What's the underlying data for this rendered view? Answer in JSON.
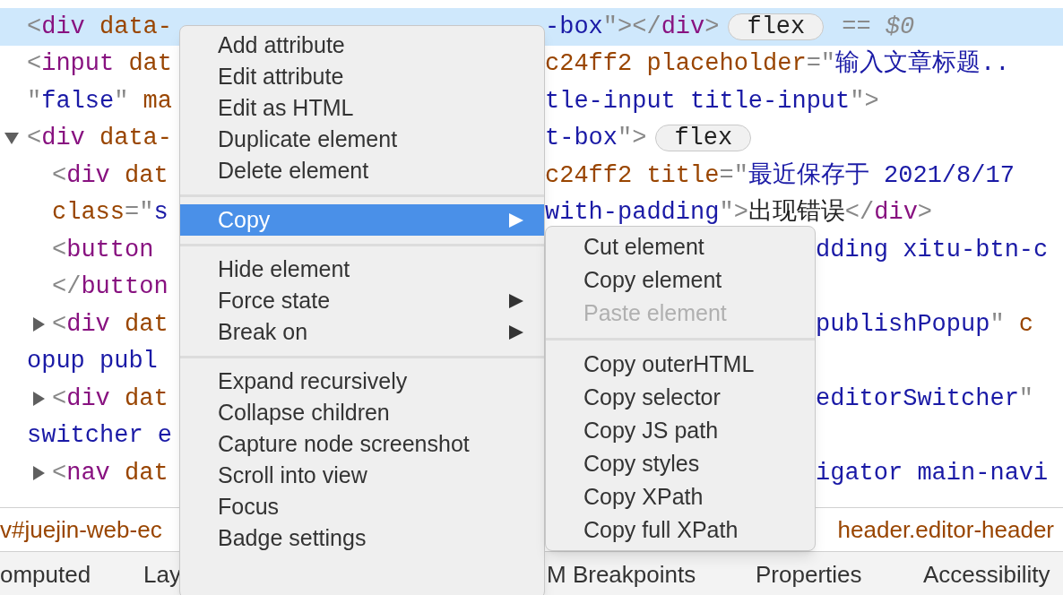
{
  "elements_tree": {
    "nodes": [
      {
        "selected": true,
        "badge": "flex",
        "console_ref": "== $0",
        "lines": [
          {
            "left": [
              {
                "kind": "punct",
                "text": "<"
              },
              {
                "kind": "tag",
                "text": "div"
              },
              {
                "kind": "attr",
                "text": " data-"
              }
            ],
            "right": [
              {
                "kind": "value",
                "text": "-box"
              },
              {
                "kind": "punct",
                "text": "\"></"
              },
              {
                "kind": "tag",
                "text": "div"
              },
              {
                "kind": "punct",
                "text": ">"
              }
            ]
          }
        ]
      },
      {
        "selected": false,
        "lines": [
          {
            "left": [
              {
                "kind": "punct",
                "text": "<"
              },
              {
                "kind": "tag",
                "text": "input"
              },
              {
                "kind": "attr",
                "text": " dat"
              }
            ],
            "right": [
              {
                "kind": "attr",
                "text": "c24ff2 placeholder"
              },
              {
                "kind": "punct",
                "text": "=\""
              },
              {
                "kind": "value",
                "text": "输入文章标题.."
              }
            ]
          },
          {
            "left": [
              {
                "kind": "punct",
                "text": "\""
              },
              {
                "kind": "value",
                "text": "false"
              },
              {
                "kind": "punct",
                "text": "\""
              },
              {
                "kind": "attr",
                "text": " ma"
              }
            ],
            "right": [
              {
                "kind": "value",
                "text": "tle-input title-input"
              },
              {
                "kind": "punct",
                "text": "\">"
              }
            ]
          }
        ]
      },
      {
        "selected": false,
        "expanded": true,
        "badge": "flex",
        "lines": [
          {
            "left": [
              {
                "kind": "punct",
                "text": "<"
              },
              {
                "kind": "tag",
                "text": "div"
              },
              {
                "kind": "attr",
                "text": " data-"
              }
            ],
            "right": [
              {
                "kind": "value",
                "text": "t-box"
              },
              {
                "kind": "punct",
                "text": "\">"
              }
            ]
          }
        ],
        "children": [
          {
            "selected": false,
            "lines": [
              {
                "left": [
                  {
                    "kind": "punct",
                    "text": "<"
                  },
                  {
                    "kind": "tag",
                    "text": "div"
                  },
                  {
                    "kind": "attr",
                    "text": " dat"
                  }
                ],
                "right": [
                  {
                    "kind": "attr",
                    "text": "c24ff2 title"
                  },
                  {
                    "kind": "punct",
                    "text": "=\""
                  },
                  {
                    "kind": "value",
                    "text": "最近保存于 2021/8/17"
                  }
                ]
              },
              {
                "left": [
                  {
                    "kind": "attr",
                    "text": "class"
                  },
                  {
                    "kind": "punct",
                    "text": "=\""
                  },
                  {
                    "kind": "value",
                    "text": "s"
                  }
                ],
                "right": [
                  {
                    "kind": "value",
                    "text": "with-padding"
                  },
                  {
                    "kind": "punct",
                    "text": "\">"
                  },
                  {
                    "kind": "content",
                    "text": "出现错误"
                  },
                  {
                    "kind": "punct",
                    "text": "</"
                  },
                  {
                    "kind": "tag",
                    "text": "div"
                  },
                  {
                    "kind": "punct",
                    "text": ">"
                  }
                ]
              }
            ]
          },
          {
            "selected": false,
            "lines": [
              {
                "left": [
                  {
                    "kind": "punct",
                    "text": "<"
                  },
                  {
                    "kind": "tag",
                    "text": "button"
                  }
                ],
                "right": [
                  {
                    "kind": "value",
                    "text": "dding xitu-btn-c"
                  }
                ]
              },
              {
                "left": [
                  {
                    "kind": "punct",
                    "text": "</"
                  },
                  {
                    "kind": "tag",
                    "text": "button"
                  }
                ]
              }
            ]
          },
          {
            "selected": false,
            "expanded": false,
            "lines": [
              {
                "left": [
                  {
                    "kind": "punct",
                    "text": "<"
                  },
                  {
                    "kind": "tag",
                    "text": "div"
                  },
                  {
                    "kind": "attr",
                    "text": " dat"
                  }
                ],
                "right": [
                  {
                    "kind": "value",
                    "text": "publishPopup"
                  },
                  {
                    "kind": "punct",
                    "text": "\""
                  },
                  {
                    "kind": "attr",
                    "text": " c"
                  }
                ]
              },
              {
                "left": [
                  {
                    "kind": "value",
                    "text": "opup publ"
                  }
                ]
              }
            ]
          },
          {
            "selected": false,
            "expanded": false,
            "lines": [
              {
                "left": [
                  {
                    "kind": "punct",
                    "text": "<"
                  },
                  {
                    "kind": "tag",
                    "text": "div"
                  },
                  {
                    "kind": "attr",
                    "text": " dat"
                  }
                ],
                "right": [
                  {
                    "kind": "value",
                    "text": "editorSwitcher"
                  },
                  {
                    "kind": "punct",
                    "text": "\""
                  }
                ]
              },
              {
                "left": [
                  {
                    "kind": "value",
                    "text": "switcher e"
                  }
                ]
              }
            ]
          },
          {
            "selected": false,
            "expanded": false,
            "lines": [
              {
                "left": [
                  {
                    "kind": "punct",
                    "text": "<"
                  },
                  {
                    "kind": "tag",
                    "text": "nav"
                  },
                  {
                    "kind": "attr",
                    "text": " dat"
                  }
                ],
                "right": [
                  {
                    "kind": "value",
                    "text": "igator main-navi"
                  }
                ]
              }
            ]
          }
        ]
      }
    ]
  },
  "breadcrumbs": {
    "left": "v#juejin-web-ec",
    "right": "header.editor-header"
  },
  "bottom_tabs": {
    "left": [
      "omputed",
      "Lay"
    ],
    "right": [
      "M Breakpoints",
      "Properties",
      "Accessibility"
    ]
  },
  "context_menu": {
    "items": [
      {
        "kind": "item",
        "label": "Add attribute",
        "selected": false
      },
      {
        "kind": "item",
        "label": "Edit attribute",
        "selected": false
      },
      {
        "kind": "item",
        "label": "Edit as HTML",
        "selected": false
      },
      {
        "kind": "item",
        "label": "Duplicate element",
        "selected": false
      },
      {
        "kind": "item",
        "label": "Delete element",
        "selected": false
      },
      {
        "kind": "separator"
      },
      {
        "kind": "item",
        "label": "Copy",
        "selected": true,
        "submenu": true
      },
      {
        "kind": "separator"
      },
      {
        "kind": "item",
        "label": "Hide element",
        "selected": false
      },
      {
        "kind": "item",
        "label": "Force state",
        "selected": false,
        "submenu": true
      },
      {
        "kind": "item",
        "label": "Break on",
        "selected": false,
        "submenu": true
      },
      {
        "kind": "separator"
      },
      {
        "kind": "item",
        "label": "Expand recursively",
        "selected": false
      },
      {
        "kind": "item",
        "label": "Collapse children",
        "selected": false
      },
      {
        "kind": "item",
        "label": "Capture node screenshot",
        "selected": false
      },
      {
        "kind": "item",
        "label": "Scroll into view",
        "selected": false
      },
      {
        "kind": "item",
        "label": "Focus",
        "selected": false
      },
      {
        "kind": "item",
        "label": "Badge settings",
        "selected": false
      }
    ]
  },
  "copy_submenu": {
    "items": [
      {
        "kind": "item",
        "label": "Cut element",
        "disabled": false
      },
      {
        "kind": "item",
        "label": "Copy element",
        "disabled": false
      },
      {
        "kind": "item",
        "label": "Paste element",
        "disabled": true
      },
      {
        "kind": "separator"
      },
      {
        "kind": "item",
        "label": "Copy outerHTML",
        "disabled": false
      },
      {
        "kind": "item",
        "label": "Copy selector",
        "disabled": false
      },
      {
        "kind": "item",
        "label": "Copy JS path",
        "disabled": false
      },
      {
        "kind": "item",
        "label": "Copy styles",
        "disabled": false
      },
      {
        "kind": "item",
        "label": "Copy XPath",
        "disabled": false
      },
      {
        "kind": "item",
        "label": "Copy full XPath",
        "disabled": false
      }
    ]
  }
}
